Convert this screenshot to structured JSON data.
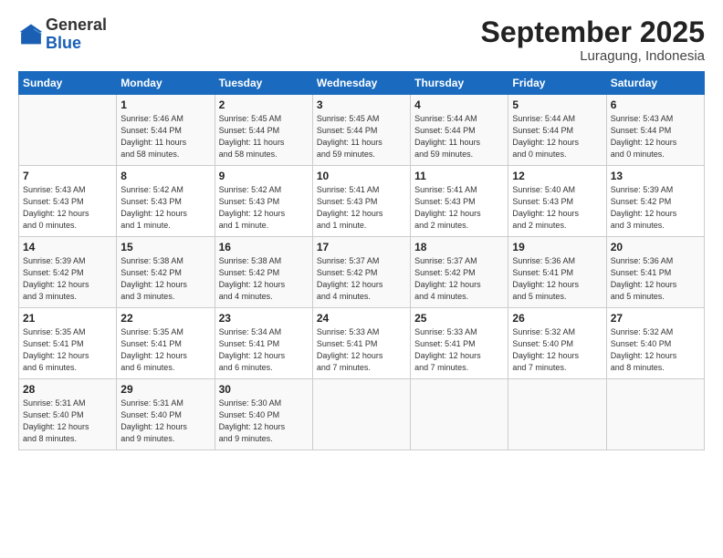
{
  "logo": {
    "line1": "General",
    "line2": "Blue"
  },
  "header": {
    "month": "September 2025",
    "location": "Luragung, Indonesia"
  },
  "days_of_week": [
    "Sunday",
    "Monday",
    "Tuesday",
    "Wednesday",
    "Thursday",
    "Friday",
    "Saturday"
  ],
  "weeks": [
    [
      {
        "day": "",
        "info": ""
      },
      {
        "day": "1",
        "info": "Sunrise: 5:46 AM\nSunset: 5:44 PM\nDaylight: 11 hours\nand 58 minutes."
      },
      {
        "day": "2",
        "info": "Sunrise: 5:45 AM\nSunset: 5:44 PM\nDaylight: 11 hours\nand 58 minutes."
      },
      {
        "day": "3",
        "info": "Sunrise: 5:45 AM\nSunset: 5:44 PM\nDaylight: 11 hours\nand 59 minutes."
      },
      {
        "day": "4",
        "info": "Sunrise: 5:44 AM\nSunset: 5:44 PM\nDaylight: 11 hours\nand 59 minutes."
      },
      {
        "day": "5",
        "info": "Sunrise: 5:44 AM\nSunset: 5:44 PM\nDaylight: 12 hours\nand 0 minutes."
      },
      {
        "day": "6",
        "info": "Sunrise: 5:43 AM\nSunset: 5:44 PM\nDaylight: 12 hours\nand 0 minutes."
      }
    ],
    [
      {
        "day": "7",
        "info": "Sunrise: 5:43 AM\nSunset: 5:43 PM\nDaylight: 12 hours\nand 0 minutes."
      },
      {
        "day": "8",
        "info": "Sunrise: 5:42 AM\nSunset: 5:43 PM\nDaylight: 12 hours\nand 1 minute."
      },
      {
        "day": "9",
        "info": "Sunrise: 5:42 AM\nSunset: 5:43 PM\nDaylight: 12 hours\nand 1 minute."
      },
      {
        "day": "10",
        "info": "Sunrise: 5:41 AM\nSunset: 5:43 PM\nDaylight: 12 hours\nand 1 minute."
      },
      {
        "day": "11",
        "info": "Sunrise: 5:41 AM\nSunset: 5:43 PM\nDaylight: 12 hours\nand 2 minutes."
      },
      {
        "day": "12",
        "info": "Sunrise: 5:40 AM\nSunset: 5:43 PM\nDaylight: 12 hours\nand 2 minutes."
      },
      {
        "day": "13",
        "info": "Sunrise: 5:39 AM\nSunset: 5:42 PM\nDaylight: 12 hours\nand 3 minutes."
      }
    ],
    [
      {
        "day": "14",
        "info": "Sunrise: 5:39 AM\nSunset: 5:42 PM\nDaylight: 12 hours\nand 3 minutes."
      },
      {
        "day": "15",
        "info": "Sunrise: 5:38 AM\nSunset: 5:42 PM\nDaylight: 12 hours\nand 3 minutes."
      },
      {
        "day": "16",
        "info": "Sunrise: 5:38 AM\nSunset: 5:42 PM\nDaylight: 12 hours\nand 4 minutes."
      },
      {
        "day": "17",
        "info": "Sunrise: 5:37 AM\nSunset: 5:42 PM\nDaylight: 12 hours\nand 4 minutes."
      },
      {
        "day": "18",
        "info": "Sunrise: 5:37 AM\nSunset: 5:42 PM\nDaylight: 12 hours\nand 4 minutes."
      },
      {
        "day": "19",
        "info": "Sunrise: 5:36 AM\nSunset: 5:41 PM\nDaylight: 12 hours\nand 5 minutes."
      },
      {
        "day": "20",
        "info": "Sunrise: 5:36 AM\nSunset: 5:41 PM\nDaylight: 12 hours\nand 5 minutes."
      }
    ],
    [
      {
        "day": "21",
        "info": "Sunrise: 5:35 AM\nSunset: 5:41 PM\nDaylight: 12 hours\nand 6 minutes."
      },
      {
        "day": "22",
        "info": "Sunrise: 5:35 AM\nSunset: 5:41 PM\nDaylight: 12 hours\nand 6 minutes."
      },
      {
        "day": "23",
        "info": "Sunrise: 5:34 AM\nSunset: 5:41 PM\nDaylight: 12 hours\nand 6 minutes."
      },
      {
        "day": "24",
        "info": "Sunrise: 5:33 AM\nSunset: 5:41 PM\nDaylight: 12 hours\nand 7 minutes."
      },
      {
        "day": "25",
        "info": "Sunrise: 5:33 AM\nSunset: 5:41 PM\nDaylight: 12 hours\nand 7 minutes."
      },
      {
        "day": "26",
        "info": "Sunrise: 5:32 AM\nSunset: 5:40 PM\nDaylight: 12 hours\nand 7 minutes."
      },
      {
        "day": "27",
        "info": "Sunrise: 5:32 AM\nSunset: 5:40 PM\nDaylight: 12 hours\nand 8 minutes."
      }
    ],
    [
      {
        "day": "28",
        "info": "Sunrise: 5:31 AM\nSunset: 5:40 PM\nDaylight: 12 hours\nand 8 minutes."
      },
      {
        "day": "29",
        "info": "Sunrise: 5:31 AM\nSunset: 5:40 PM\nDaylight: 12 hours\nand 9 minutes."
      },
      {
        "day": "30",
        "info": "Sunrise: 5:30 AM\nSunset: 5:40 PM\nDaylight: 12 hours\nand 9 minutes."
      },
      {
        "day": "",
        "info": ""
      },
      {
        "day": "",
        "info": ""
      },
      {
        "day": "",
        "info": ""
      },
      {
        "day": "",
        "info": ""
      }
    ]
  ]
}
